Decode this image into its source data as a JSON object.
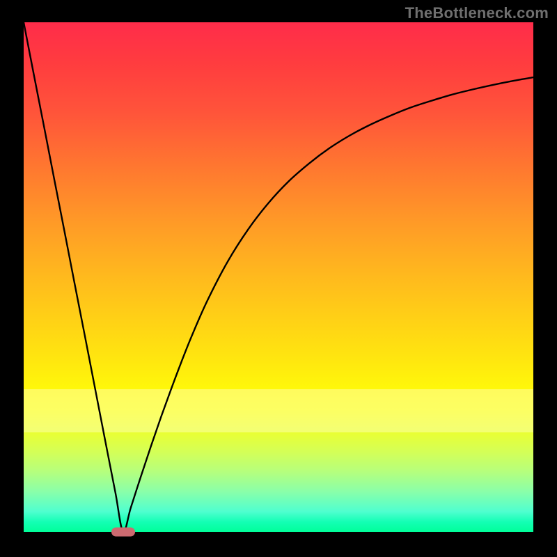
{
  "watermark": "TheBottleneck.com",
  "colors": {
    "frame": "#000000",
    "curve": "#000000",
    "marker": "#cc6a70",
    "gradient_top": "#ff2c4a",
    "gradient_bottom": "#00ff99"
  },
  "chart_data": {
    "type": "line",
    "title": "",
    "xlabel": "",
    "ylabel": "",
    "xlim": [
      0,
      100
    ],
    "ylim": [
      0,
      100
    ],
    "grid": false,
    "legend": false,
    "x": [
      0,
      2,
      4,
      6,
      8,
      10,
      12,
      14,
      16,
      18,
      19.5,
      21,
      23,
      25,
      27,
      29,
      31,
      33,
      36,
      40,
      44,
      48,
      52,
      56,
      60,
      64,
      68,
      72,
      76,
      80,
      84,
      88,
      92,
      96,
      100
    ],
    "values": [
      100,
      89.7,
      79.5,
      69.2,
      59.0,
      48.7,
      38.5,
      28.2,
      17.9,
      7.7,
      0,
      4.7,
      10.9,
      16.9,
      22.7,
      28.2,
      33.5,
      38.5,
      45.3,
      53.0,
      59.3,
      64.5,
      68.8,
      72.3,
      75.3,
      77.8,
      79.9,
      81.7,
      83.3,
      84.6,
      85.8,
      86.8,
      87.7,
      88.5,
      89.2
    ],
    "marker": {
      "x": 19.5,
      "y": 0
    }
  }
}
